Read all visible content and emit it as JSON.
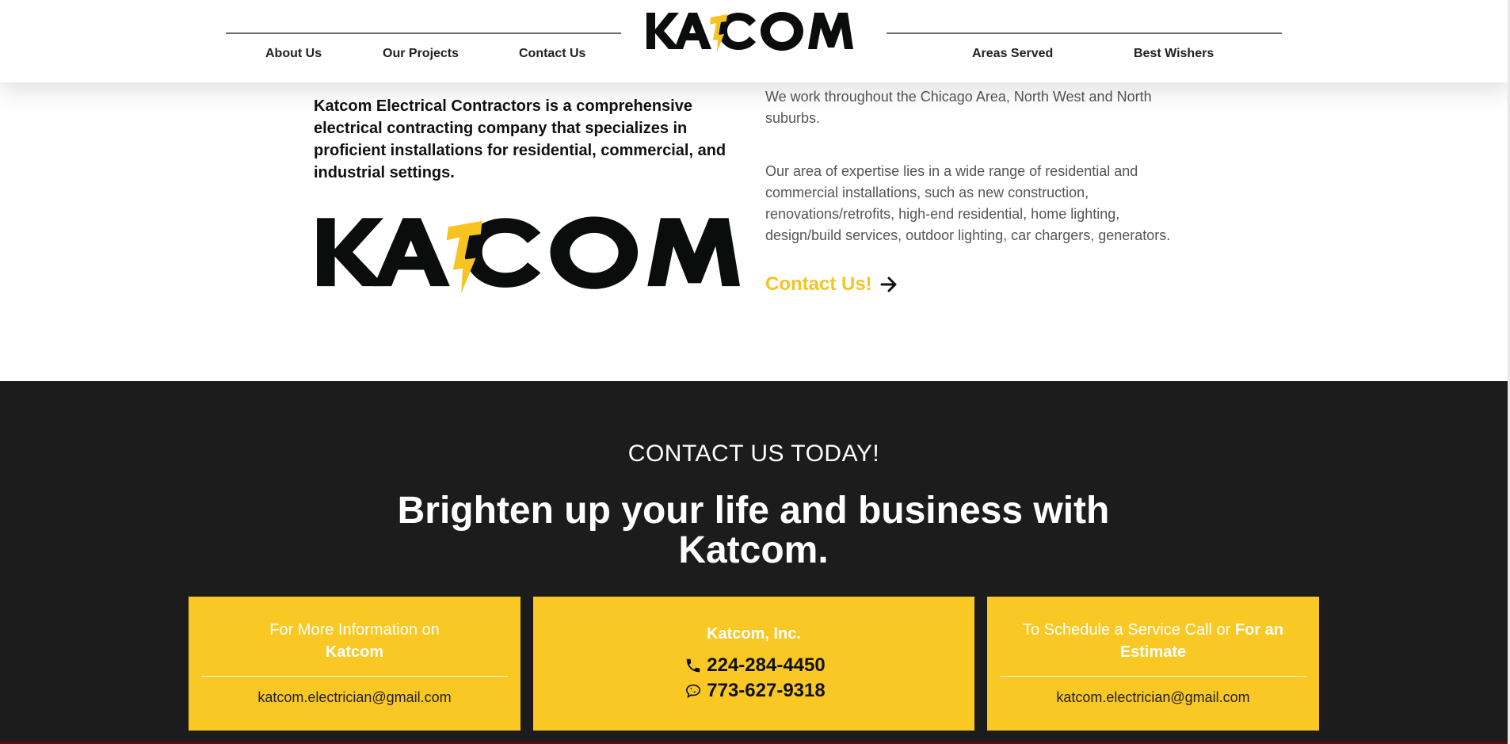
{
  "brand": {
    "name": "KATCOM",
    "accent_color": "#f7c321",
    "dark_color": "#0a0d0c"
  },
  "header": {
    "nav_left": [
      "About Us",
      "Our Projects",
      "Contact Us"
    ],
    "nav_right": [
      "Areas Served",
      "Best Wishers"
    ]
  },
  "intro": {
    "description": "Katcom Electrical Contractors is a comprehensive electrical contracting company that specializes in proficient installations for residential, commercial, and industrial settings.",
    "areas": "We work throughout the Chicago Area, North West and North suburbs.",
    "expertise": "Our area of expertise lies in a wide range of residential and commercial installations, such as new construction, renovations/retrofits, high-end residential, home lighting, design/build services, outdoor lighting, car chargers, generators.",
    "contact_link": "Contact Us!",
    "contact_link_icon": "arrow-right-icon"
  },
  "cta": {
    "background": "#1c1c1d",
    "kicker": "CONTACT US TODAY!",
    "title": "Brighten up your life and business with Katcom.",
    "box_color": "#fac824",
    "info_box": {
      "prefix": "For More Information on",
      "bold": "Katcom",
      "email": "katcom.electrician@gmail.com"
    },
    "company_box": {
      "name": "Katcom, Inc.",
      "phone": "224-284-4450",
      "phone_icon": "phone-icon",
      "mobile": "773-627-9318",
      "mobile_icon": "chat-bubble-icon"
    },
    "schedule_box": {
      "prefix": "To Schedule a Service Call or",
      "bold": "For an Estimate",
      "email": "katcom.electrician@gmail.com"
    }
  }
}
